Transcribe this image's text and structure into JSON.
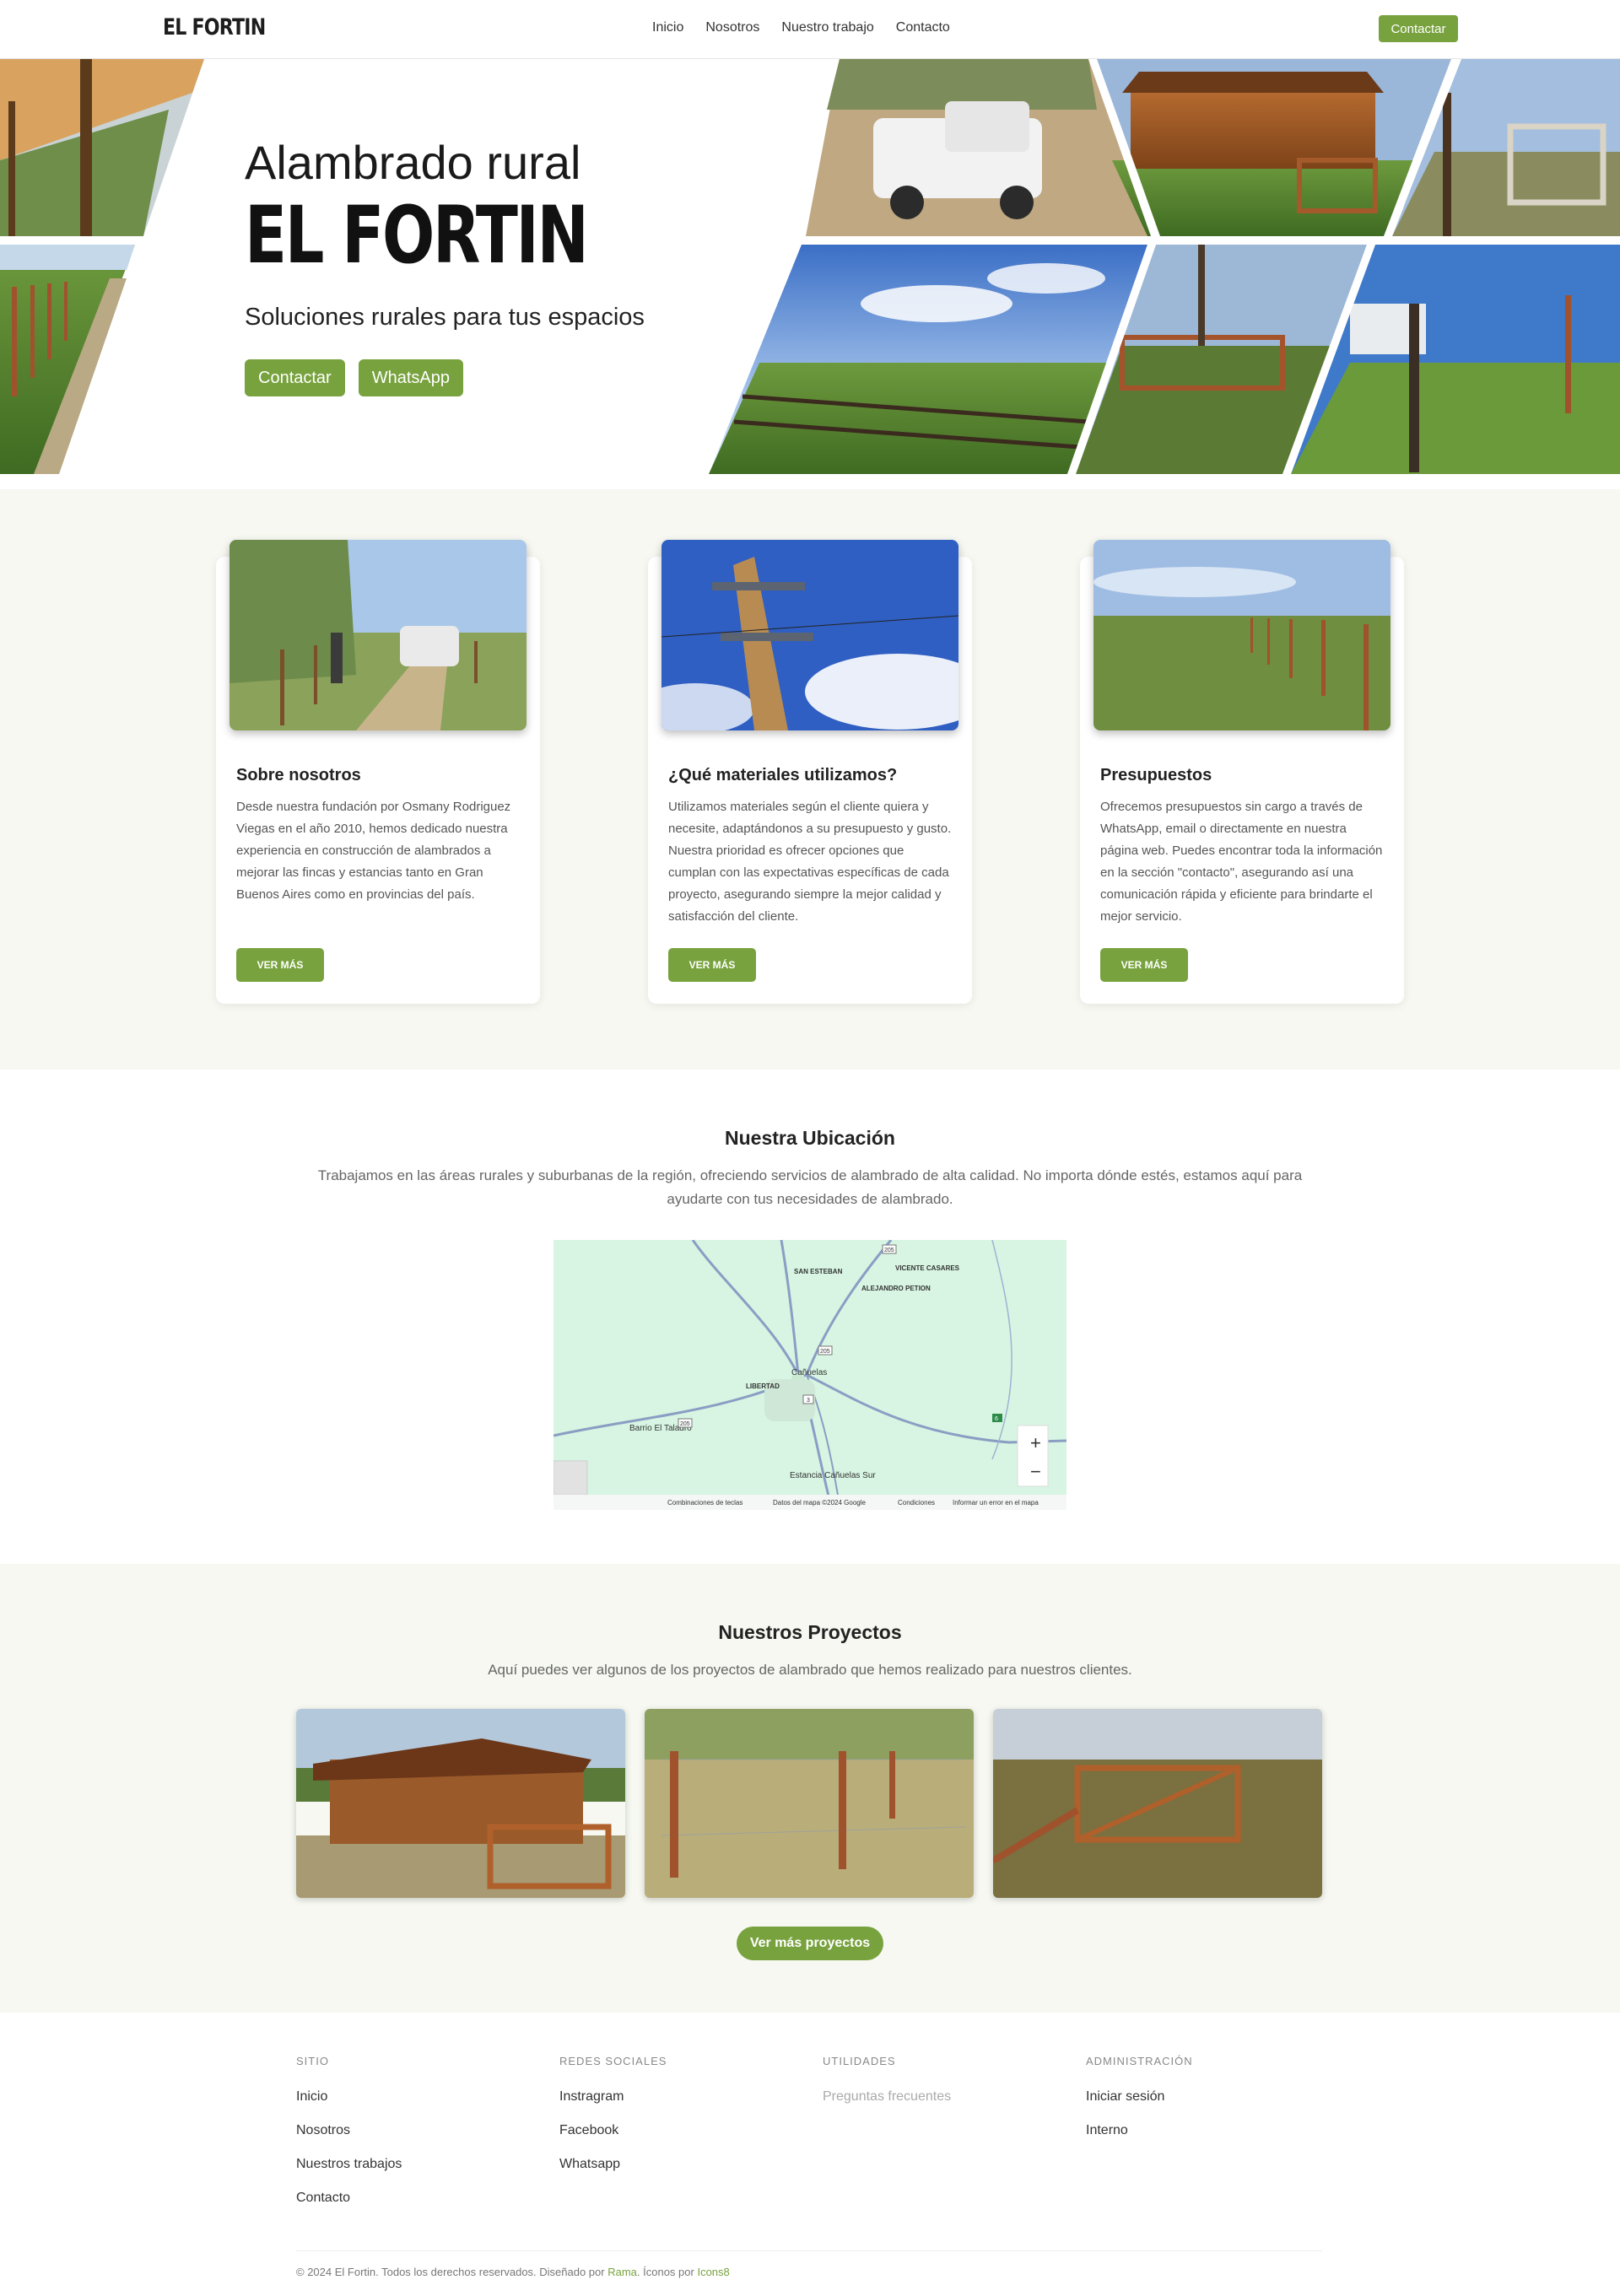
{
  "nav": {
    "logo": "EL FORTIN",
    "links": [
      "Inicio",
      "Nosotros",
      "Nuestro trabajo",
      "Contacto"
    ],
    "cta": "Contactar"
  },
  "hero": {
    "title": "Alambrado rural",
    "brand": "EL FORTIN",
    "subtitle": "Soluciones rurales para tus espacios",
    "buttons": [
      "Contactar",
      "WhatsApp"
    ]
  },
  "features": [
    {
      "title": "Sobre nosotros",
      "text": "Desde nuestra fundación por Osmany Rodriguez Viegas en el año 2010, hemos dedicado nuestra experiencia en construcción de alambrados a mejorar las fincas y estancias tanto en Gran Buenos Aires como en provincias del país.",
      "button": "VER MÁS"
    },
    {
      "title": "¿Qué materiales utilizamos?",
      "text": "Utilizamos materiales según el cliente quiera y necesite, adaptándonos a su presupuesto y gusto. Nuestra prioridad es ofrecer opciones que cumplan con las expectativas específicas de cada proyecto, asegurando siempre la mejor calidad y satisfacción del cliente.",
      "button": "VER MÁS"
    },
    {
      "title": "Presupuestos",
      "text": "Ofrecemos presupuestos sin cargo a través de WhatsApp, email o directamente en nuestra página web. Puedes encontrar toda la información en la sección \"contacto\", asegurando así una comunicación rápida y eficiente para brindarte el mejor servicio.",
      "button": "VER MÁS"
    }
  ],
  "location": {
    "title": "Nuestra Ubicación",
    "text": "Trabajamos en las áreas rurales y suburbanas de la región, ofreciendo servicios de alambrado de alta calidad. No importa dónde estés, estamos aquí para ayudarte con tus necesidades de alambrado.",
    "map": {
      "places": [
        "SAN ESTEBAN",
        "VICENTE CASARES",
        "ALEJANDRO PETION",
        "LIBERTAD",
        "Cañuelas",
        "Barrio El Taladro",
        "Estancia Cañuelas Sur"
      ],
      "routes": [
        "205",
        "205",
        "3",
        "205",
        "6"
      ],
      "zoom_in": "+",
      "zoom_out": "−",
      "footer": [
        "Combinaciones de teclas",
        "Datos del mapa ©2024 Google",
        "Condiciones",
        "Informar un error en el mapa"
      ]
    }
  },
  "projects": {
    "title": "Nuestros Proyectos",
    "text": "Aquí puedes ver algunos de los proyectos de alambrado que hemos realizado para nuestros clientes.",
    "button": "Ver más proyectos"
  },
  "footer": {
    "columns": [
      {
        "heading": "SITIO",
        "links": [
          "Inicio",
          "Nosotros",
          "Nuestros trabajos",
          "Contacto"
        ]
      },
      {
        "heading": "REDES SOCIALES",
        "links": [
          "Instragram",
          "Facebook",
          "Whatsapp"
        ]
      },
      {
        "heading": "UTILIDADES",
        "links": [
          "Preguntas frecuentes"
        ]
      },
      {
        "heading": "ADMINISTRACIÓN",
        "links": [
          "Iniciar sesión",
          "Interno"
        ]
      }
    ],
    "copyright": "© 2024 El Fortin. Todos los derechos reservados. Diseñado por",
    "designer": "Rama",
    "icons_prefix": ". Íconos por",
    "icons_by": "Icons8"
  },
  "colors": {
    "accent": "#78a23e",
    "section_bg": "#f6f8f1",
    "map_bg": "#d7f5e2"
  }
}
